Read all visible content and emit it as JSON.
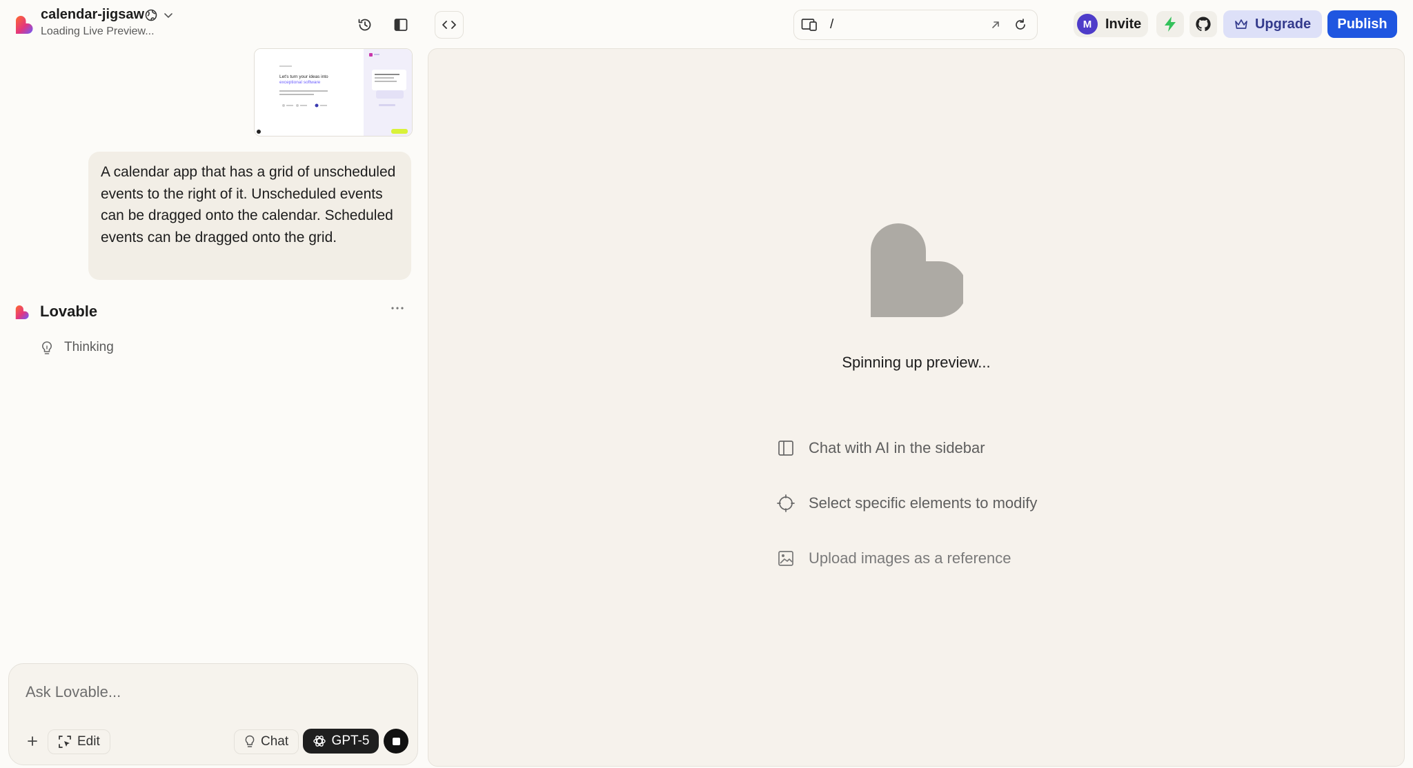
{
  "header": {
    "project_name": "calendar-jigsaw",
    "status": "Loading Live Preview...",
    "url_path": "/",
    "avatar_initial": "M",
    "invite_label": "Invite",
    "upgrade_label": "Upgrade",
    "publish_label": "Publish"
  },
  "chat": {
    "user_message": "A calendar app that has a grid of unscheduled events to the right of it. Unscheduled events can be dragged onto the calendar. Scheduled events can be dragged onto the grid.",
    "assistant_name": "Lovable",
    "thinking_label": "Thinking",
    "thumbnail": {
      "headline_line1": "Let's turn your ideas into",
      "headline_line2": "exceptional software"
    }
  },
  "composer": {
    "placeholder": "Ask Lovable...",
    "edit_label": "Edit",
    "chat_label": "Chat",
    "model_label": "GPT-5"
  },
  "preview": {
    "status": "Spinning up preview...",
    "tips": [
      {
        "label": "Chat with AI in the sidebar",
        "icon": "sidebar-panel-icon"
      },
      {
        "label": "Select specific elements to modify",
        "icon": "crosshair-icon"
      },
      {
        "label": "Upload images as a reference",
        "icon": "image-icon"
      }
    ]
  },
  "colors": {
    "brand_gradient": [
      "#ff4d2e",
      "#c837ab",
      "#6a5cff"
    ],
    "publish": "#1f56e0",
    "upgrade_bg": "#dde0f8",
    "bolt": "#34c15b"
  }
}
